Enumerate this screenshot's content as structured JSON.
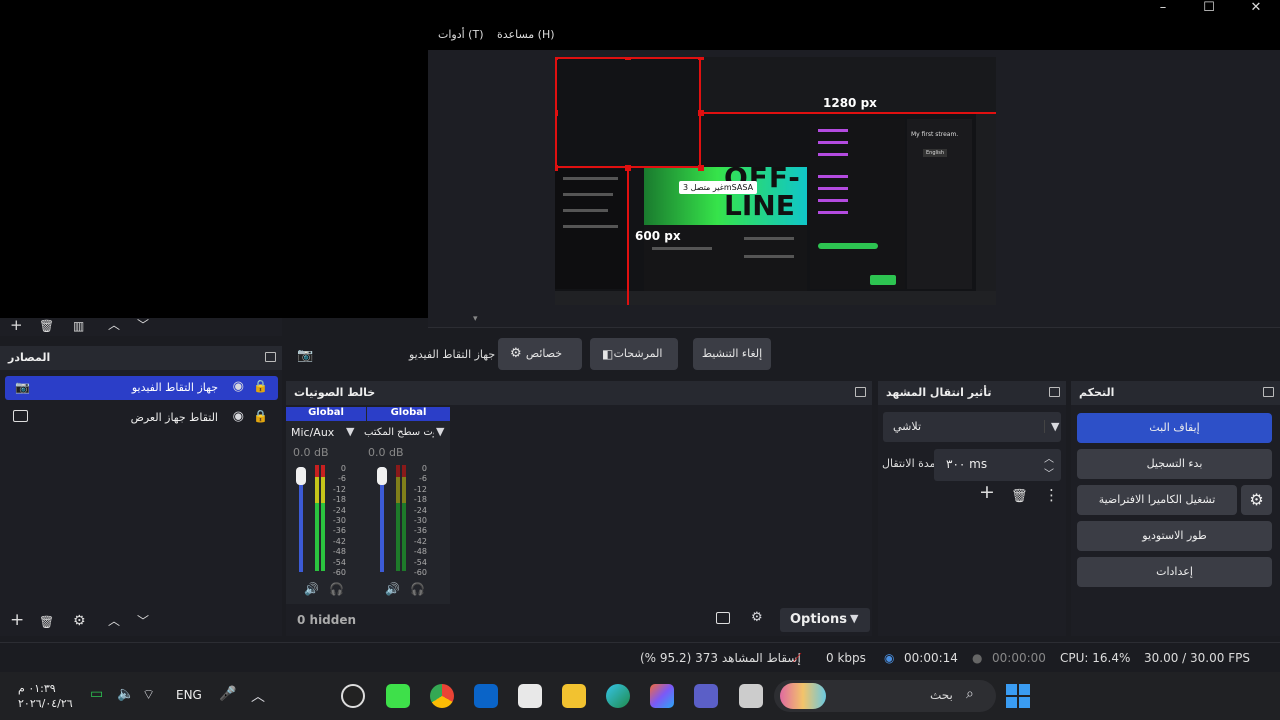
{
  "window": {
    "minimize": "–",
    "maximize": "☐",
    "close": "✕"
  },
  "menu": [
    "أدوات (T)",
    "مساعدة (H)"
  ],
  "preview": {
    "width_label": "1280 px",
    "height_label": "600 px",
    "tooltip": "غير متصل 3mSASA",
    "stream_title": "My first stream.",
    "language": "English",
    "offline_line1": "OFF-",
    "offline_line2": "LINE"
  },
  "preview_toolbar": {
    "label": "جهاز التقاط الفيديو",
    "properties": "خصائص",
    "filters": "المرشحات",
    "deactivate": "إلغاء التنشيط"
  },
  "sources": {
    "title": "المصادر",
    "items": [
      {
        "label": "جهاز التقاط الفيديو",
        "icon": "camera-icon",
        "selected": true
      },
      {
        "label": "التقاط جهاز العرض",
        "icon": "monitor-icon",
        "selected": false
      }
    ]
  },
  "mixer": {
    "title": "خالط الصوتيات",
    "channels": [
      {
        "tag": "Global",
        "name": "Mic/Aux",
        "db": "0.0 dB"
      },
      {
        "tag": "Global",
        "name": "صوت سطح المكتب",
        "db": "0.0 dB"
      }
    ],
    "scale": [
      "0",
      "-6",
      "-12",
      "-18",
      "-24",
      "-30",
      "-36",
      "-42",
      "-48",
      "-54",
      "-60"
    ],
    "hidden": "0 hidden",
    "options": "Options"
  },
  "transitions": {
    "title": "تأثير انتقال المشهد",
    "type": "تلاشي",
    "duration_label": "مدة الانتقال",
    "duration_value": "٣٠٠ ms"
  },
  "controls": {
    "title": "التحكم",
    "stop_stream": "إيقاف البث",
    "start_recording": "بدء التسجيل",
    "virtual_camera": "تشغيل الكاميرا الافتراضية",
    "studio_mode": "طور الاستوديو",
    "settings": "إعدادات"
  },
  "status": {
    "dropped": "إسقاط المشاهد 373 (95.2 %)",
    "kbps": "0 kbps",
    "stream_time": "00:00:14",
    "rec_time": "00:00:00",
    "cpu": "CPU: 16.4%",
    "fps": "30.00 / 30.00 FPS"
  },
  "taskbar": {
    "time": "٠١:٣٩ م",
    "date": "٢٠٢٦/٠٤/٢٦",
    "lang": "ENG",
    "search": "بحث"
  },
  "colors": {
    "accent": "#2d50c8",
    "selected": "#2b3ec8",
    "red": "#e01010"
  }
}
